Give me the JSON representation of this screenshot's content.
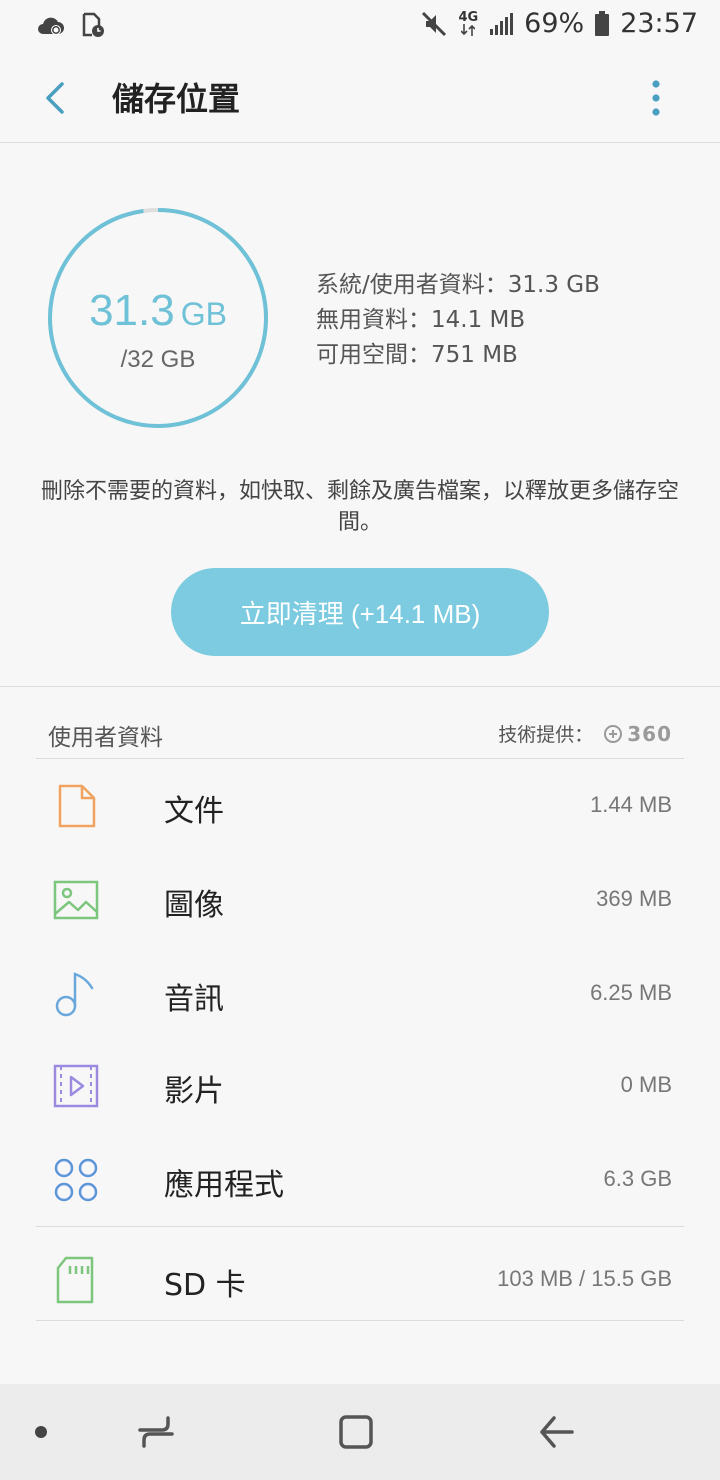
{
  "status_bar": {
    "network": "4G",
    "battery": "69%",
    "time": "23:57"
  },
  "header": {
    "title": "儲存位置"
  },
  "storage": {
    "used_value": "31.3",
    "used_unit": "GB",
    "total": "/32 GB",
    "used_fraction": 0.978,
    "stats": [
      "系統/使用者資料：31.3 GB",
      "無用資料：14.1 MB",
      "可用空間：751 MB"
    ],
    "description": "刪除不需要的資料，如快取、剩餘及廣告檔案，以釋放更多儲存空間。",
    "clean_label": "立即清理 (+14.1 MB)"
  },
  "user_data": {
    "heading": "使用者資料",
    "provider_label": "技術提供：",
    "provider_logo": "360",
    "items": [
      {
        "label": "文件",
        "size": "1.44 MB",
        "icon": "document-icon"
      },
      {
        "label": "圖像",
        "size": "369 MB",
        "icon": "image-icon"
      },
      {
        "label": "音訊",
        "size": "6.25 MB",
        "icon": "music-icon"
      },
      {
        "label": "影片",
        "size": "0 MB",
        "icon": "video-icon"
      },
      {
        "label": "應用程式",
        "size": "6.3 GB",
        "icon": "apps-icon"
      }
    ]
  },
  "sd_card": {
    "label": "SD 卡",
    "size": "103 MB / 15.5 GB",
    "icon": "sd-card-icon"
  },
  "colors": {
    "accent": "#7ccbe0",
    "ring": "#6ec1d6",
    "document": "#f0a35e",
    "image": "#7dc67d",
    "music": "#6aa8dc",
    "video": "#9b8ae0",
    "apps": "#5d95d8",
    "sd": "#7dc67d"
  }
}
